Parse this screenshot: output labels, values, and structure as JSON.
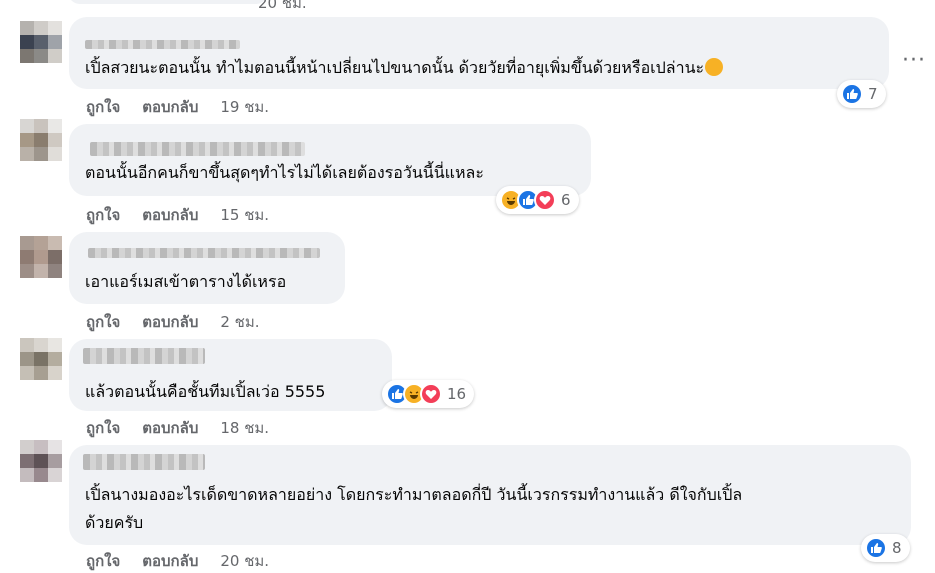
{
  "top_time": "20 ชม.",
  "more_label": "···",
  "comments": [
    {
      "text_lines": [
        "เปิ้ลสวยนะตอนนั้น ทำไมตอนนี้หน้าเปลี่ยนไปขนาดนั้น ด้วยวัยที่อายุเพิ่มขึ้นด้วยหรือเปล่านะ"
      ],
      "like": "ถูกใจ",
      "reply": "ตอบกลับ",
      "time": "19 ชม.",
      "reactions": [
        "like"
      ],
      "reaction_count": "7"
    },
    {
      "text_lines": [
        "ตอนนั้นอีกคนก็ขาขึ้นสุดๆทำไรไม่ได้เลยต้องรอวันนี้นี่แหละ"
      ],
      "like": "ถูกใจ",
      "reply": "ตอบกลับ",
      "time": "15 ชม.",
      "reactions": [
        "haha",
        "like",
        "love"
      ],
      "reaction_count": "6"
    },
    {
      "text_lines": [
        "เอาแอร์เมสเข้าตารางได้เหรอ"
      ],
      "like": "ถูกใจ",
      "reply": "ตอบกลับ",
      "time": "2 ชม.",
      "reactions": [],
      "reaction_count": ""
    },
    {
      "text_lines": [
        "แล้วตอนนั้นคือชั้นทีมเปิ้ลเว่อ 5555"
      ],
      "like": "ถูกใจ",
      "reply": "ตอบกลับ",
      "time": "18 ชม.",
      "reactions": [
        "like",
        "haha",
        "love"
      ],
      "reaction_count": "16"
    },
    {
      "text_lines": [
        "เปิ้ลนางมองอะไรเด็ดขาดหลายอย่าง โดยกระทำมาตลอดกี่ปี วันนี้เวรกรรมทำงานแล้ว ดีใจกับเปิ้ล",
        "ด้วยครับ"
      ],
      "like": "ถูกใจ",
      "reply": "ตอบกลับ",
      "time": "20 ชม.",
      "reactions": [
        "like"
      ],
      "reaction_count": "8"
    }
  ],
  "colors": {
    "bubble": "#f0f2f5",
    "secondary_text": "#65676b",
    "like_blue": "#1b74e4",
    "haha_yellow": "#f7b125",
    "love_red": "#f33e58"
  }
}
